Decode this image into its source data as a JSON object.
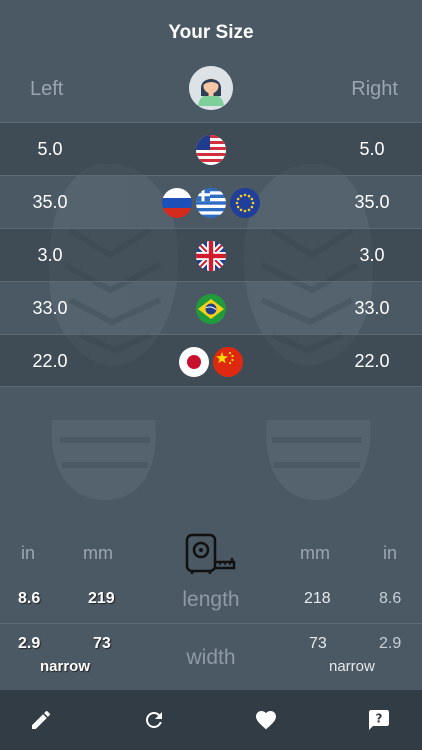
{
  "header": {
    "title": "Your Size",
    "left_label": "Left",
    "right_label": "Right"
  },
  "avatar": {
    "icon": "woman-avatar-icon"
  },
  "sizes": [
    {
      "left": "5.0",
      "right": "5.0",
      "flags": [
        "us-flag-icon"
      ]
    },
    {
      "left": "35.0",
      "right": "35.0",
      "flags": [
        "russia-flag-icon",
        "greece-flag-icon",
        "eu-flag-icon"
      ]
    },
    {
      "left": "3.0",
      "right": "3.0",
      "flags": [
        "uk-flag-icon"
      ]
    },
    {
      "left": "33.0",
      "right": "33.0",
      "flags": [
        "brazil-flag-icon"
      ]
    },
    {
      "left": "22.0",
      "right": "22.0",
      "flags": [
        "japan-flag-icon",
        "china-flag-icon"
      ]
    }
  ],
  "measurements": {
    "unit_in": "in",
    "unit_mm": "mm",
    "length_label": "length",
    "width_label": "width",
    "left": {
      "length_in": "8.6",
      "length_mm": "219",
      "width_in": "2.9",
      "width_mm": "73",
      "width_class": "narrow"
    },
    "right": {
      "length_in": "8.6",
      "length_mm": "218",
      "width_in": "2.9",
      "width_mm": "73",
      "width_class": "narrow"
    },
    "tape_icon": "tape-measure-icon"
  },
  "bottom_nav": [
    {
      "icon": "pencil-icon"
    },
    {
      "icon": "refresh-icon"
    },
    {
      "icon": "heart-icon"
    },
    {
      "icon": "help-icon"
    }
  ],
  "colors": {
    "background": "#4b5964",
    "bottom_bar": "#323c44",
    "muted_text": "#9aa6b0"
  }
}
